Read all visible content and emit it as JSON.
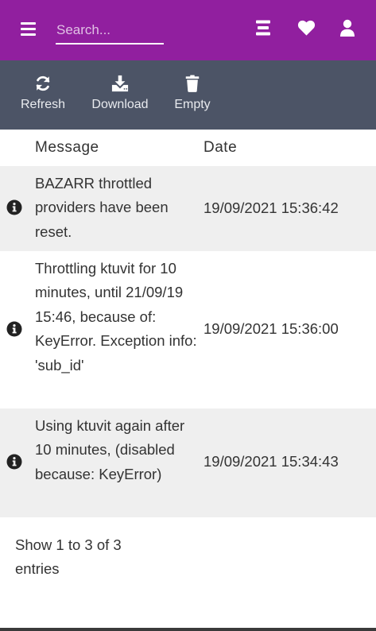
{
  "header": {
    "search_placeholder": "Search...",
    "bg_color": "#911f9f"
  },
  "toolbar": {
    "bg_color": "#4c5466",
    "buttons": [
      {
        "label": "Refresh",
        "icon": "refresh-icon"
      },
      {
        "label": "Download",
        "icon": "download-icon"
      },
      {
        "label": "Empty",
        "icon": "trash-icon"
      }
    ]
  },
  "table": {
    "columns": [
      "Message",
      "Date"
    ],
    "rows": [
      {
        "icon": "info-icon",
        "message": "BAZARR throttled providers have been reset.",
        "date": "19/09/2021 15:36:42"
      },
      {
        "icon": "info-icon",
        "message": "Throttling ktuvit for 10 minutes, until 21/09/19 15:46, because of: KeyError. Exception info: 'sub_id'",
        "date": "19/09/2021 15:36:00"
      },
      {
        "icon": "info-icon",
        "message": "Using ktuvit again after 10 minutes, (disabled because: KeyError)",
        "date": "19/09/2021 15:34:43"
      }
    ]
  },
  "footer": {
    "entries_info": "Show 1 to 3 of 3 entries"
  }
}
